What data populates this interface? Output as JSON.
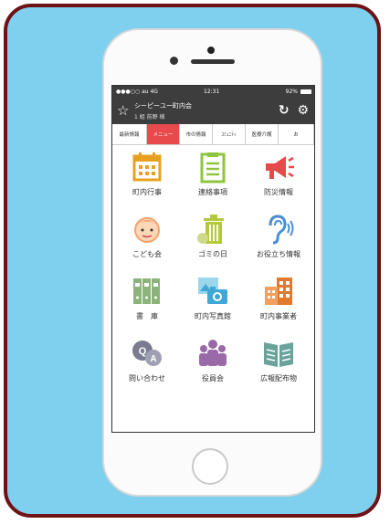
{
  "status_bar": {
    "carrier": "●●●○○ au 4G",
    "time": "12:31",
    "battery": "92%"
  },
  "header": {
    "title": "シーピーユー町内会",
    "subtitle": "1 組  前野 様",
    "reload_icon": "reload-icon",
    "settings_icon": "gear-icon",
    "favorite_icon": "star-icon"
  },
  "tabs": [
    {
      "label": "最新情報",
      "active": false
    },
    {
      "label": "メニュー",
      "active": true
    },
    {
      "label": "市の情報",
      "active": false
    },
    {
      "label": "ｺﾐｭﾆﾃｨ",
      "active": false
    },
    {
      "label": "医療介護",
      "active": false
    },
    {
      "label": "お",
      "active": false
    }
  ],
  "menu": [
    {
      "label": "町内行事",
      "icon": "calendar-icon",
      "color": "#e8a020"
    },
    {
      "label": "連絡事項",
      "icon": "clipboard-icon",
      "color": "#8cc63f"
    },
    {
      "label": "防災情報",
      "icon": "megaphone-icon",
      "color": "#e8494a"
    },
    {
      "label": "こども会",
      "icon": "child-face-icon",
      "color": "#f7a16e"
    },
    {
      "label": "ゴミの日",
      "icon": "trash-can-icon",
      "color": "#b5c93a"
    },
    {
      "label": "お役立ち情報",
      "icon": "ear-icon",
      "color": "#4a8fd0"
    },
    {
      "label": "書　庫",
      "icon": "binders-icon",
      "color": "#8cb47a"
    },
    {
      "label": "町内写真館",
      "icon": "camera-photo-icon",
      "color": "#3fa8d6"
    },
    {
      "label": "町内事業者",
      "icon": "buildings-icon",
      "color": "#e07a2e"
    },
    {
      "label": "問い合わせ",
      "icon": "qa-bubbles-icon",
      "color": "#7a7a90"
    },
    {
      "label": "役員会",
      "icon": "people-group-icon",
      "color": "#9a6aa8"
    },
    {
      "label": "広報配布物",
      "icon": "open-book-icon",
      "color": "#6aa39a"
    }
  ]
}
